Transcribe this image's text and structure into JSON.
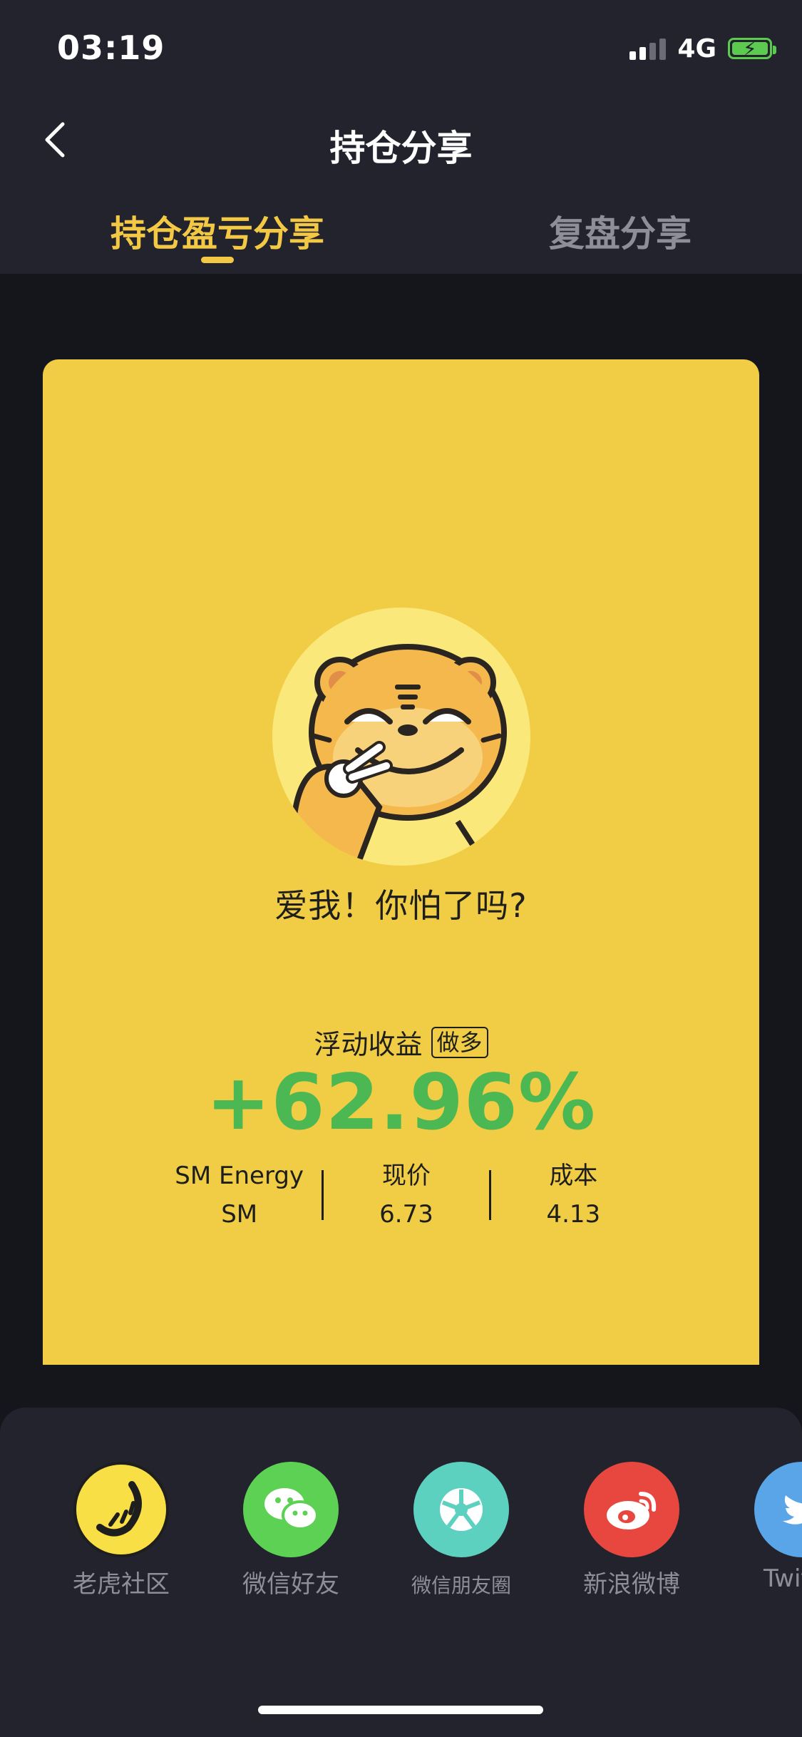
{
  "status_bar": {
    "time": "03:19",
    "network": "4G"
  },
  "nav": {
    "title": "持仓分享"
  },
  "tabs": [
    {
      "label": "持仓盈亏分享",
      "active": true
    },
    {
      "label": "复盘分享",
      "active": false
    }
  ],
  "card": {
    "background_color": "#f0cd45",
    "quote": "爱我！你怕了吗?",
    "gain_label": "浮动收益",
    "gain_tag": "做多",
    "gain_value": "+62.96%",
    "gain_color": "#4cb854",
    "stock": {
      "name": "SM Energy",
      "ticker": "SM"
    },
    "current_price": {
      "label": "现价",
      "value": "6.73"
    },
    "cost": {
      "label": "成本",
      "value": "4.13"
    }
  },
  "share_targets": [
    {
      "label": "老虎社区",
      "icon": "tiger-community-icon",
      "color": "#f7df45"
    },
    {
      "label": "微信好友",
      "icon": "wechat-icon",
      "color": "#5cd154"
    },
    {
      "label": "微信朋友圈",
      "icon": "wechat-moments-icon",
      "color": "#5dd1c0"
    },
    {
      "label": "新浪微博",
      "icon": "weibo-icon",
      "color": "#e8473f"
    },
    {
      "label": "Twitter",
      "icon": "twitter-icon",
      "color": "#5aa5e8"
    }
  ]
}
